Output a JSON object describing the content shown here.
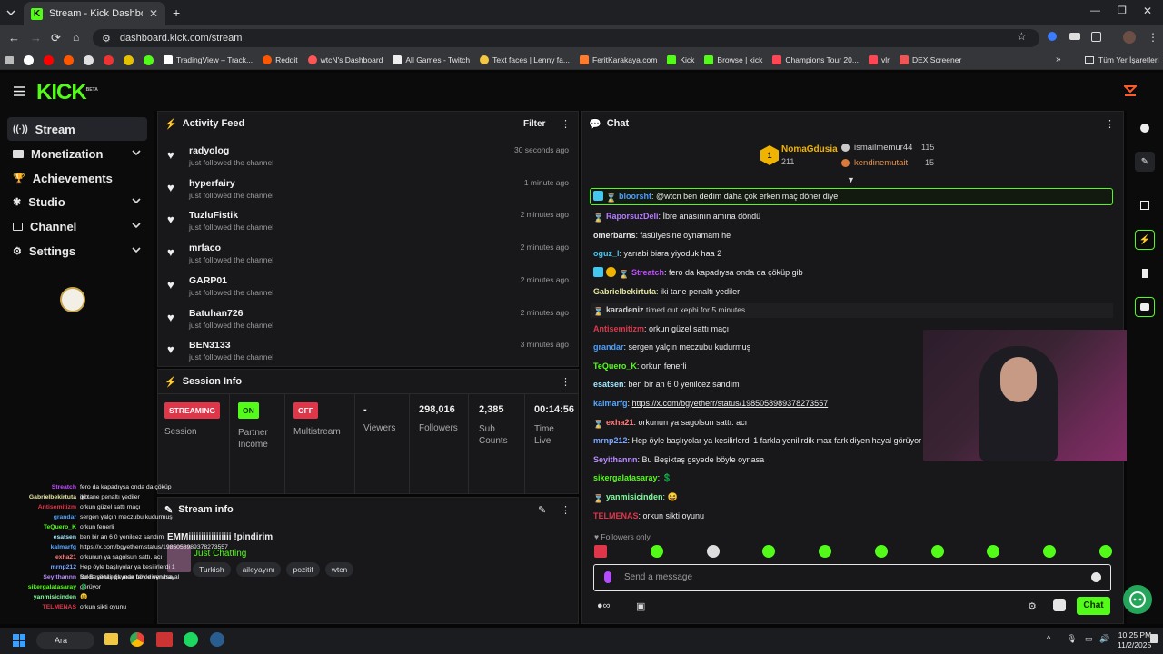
{
  "browser": {
    "tab_title": "Stream - Kick Dashboard",
    "url": "dashboard.kick.com/stream",
    "bookmarks": [
      "TradingView – Track...",
      "Reddit",
      "wtcN's Dashboard",
      "All Games - Twitch",
      "Text faces | Lenny fa...",
      "FeritKarakaya.com",
      "Kick",
      "Browse | kick",
      "Champions Tour 20...",
      "vlr",
      "DEX Screener"
    ],
    "all_bookmarks": "Tüm Yer İşaretleri"
  },
  "app": {
    "logo": "KICK",
    "logo_tag": "BETA"
  },
  "nav": [
    {
      "label": "Stream",
      "icon": "stream-icon",
      "active": true
    },
    {
      "label": "Monetization",
      "icon": "money-icon",
      "expand": true
    },
    {
      "label": "Achievements",
      "icon": "trophy-icon",
      "expand": false
    },
    {
      "label": "Studio",
      "icon": "studio-icon",
      "expand": true
    },
    {
      "label": "Channel",
      "icon": "channel-icon",
      "expand": true
    },
    {
      "label": "Settings",
      "icon": "gear-icon",
      "expand": true
    }
  ],
  "activity": {
    "title": "Activity Feed",
    "filter": "Filter",
    "items": [
      {
        "name": "radyolog",
        "action": "just followed the channel",
        "time": "30 seconds ago"
      },
      {
        "name": "hyperfairy",
        "action": "just followed the channel",
        "time": "1 minute ago"
      },
      {
        "name": "TuzluFistik",
        "action": "just followed the channel",
        "time": "2 minutes ago"
      },
      {
        "name": "mrfaco",
        "action": "just followed the channel",
        "time": "2 minutes ago"
      },
      {
        "name": "GARP01",
        "action": "just followed the channel",
        "time": "2 minutes ago"
      },
      {
        "name": "Batuhan726",
        "action": "just followed the channel",
        "time": "2 minutes ago"
      },
      {
        "name": "BEN3133",
        "action": "just followed the channel",
        "time": "3 minutes ago"
      }
    ]
  },
  "session": {
    "title": "Session Info",
    "streaming_badge": "STREAMING",
    "session_label": "Session",
    "on_badge": "ON",
    "partner_label": "Partner Income",
    "off_badge": "OFF",
    "multistream_label": "Multistream",
    "viewers_value": "-",
    "viewers_label": "Viewers",
    "followers_value": "298,016",
    "followers_label": "Followers",
    "subs_value": "2,385",
    "subs_label": "Sub Counts",
    "time_value": "00:14:56",
    "time_label": "Time Live"
  },
  "stream_info": {
    "title": "Stream info",
    "stream_title": "EMMiiiiiiiiiiiiiiiii !pindirim",
    "category": "Just Chatting",
    "tags": [
      "Turkish",
      "aileyayını",
      "pozitif",
      "wtcn"
    ]
  },
  "chat": {
    "title": "Chat",
    "top1": {
      "rank": "1",
      "name": "NomaGdusia",
      "count": "211"
    },
    "top2": {
      "name": "ismailmemur44",
      "count": "115"
    },
    "top3": {
      "name": "kendinemutait",
      "count": "15"
    },
    "messages": [
      {
        "user": "bloorsht",
        "color": "#4a9cff",
        "text": "@wtcn ben dedim daha çok erken maç döner diye",
        "highlight": true
      },
      {
        "user": "RaporsuzDeli",
        "color": "#b57cff",
        "text": "İbre anasının amına döndü"
      },
      {
        "user": "omerbarns",
        "color": "#e8e8e8",
        "text": "fasülyesine oynamam he"
      },
      {
        "user": "oguz_l",
        "color": "#45c8f0",
        "text": "yarıabi biara yiyoduk haa 2"
      },
      {
        "user": "Streatch",
        "color": "#c04cff",
        "text": "fero da kapadıysa onda da çöküp gib"
      },
      {
        "user": "Gabrielbekirtuta",
        "color": "#e6e6a0",
        "text": "iki tane penaltı yediler"
      },
      {
        "user": "karadeniz",
        "color": "#d0d0d0",
        "text": "timed out xephi for 5 minutes",
        "system": true
      },
      {
        "user": "Antisemitizm",
        "color": "#e0364a",
        "text": "orkun güzel sattı maçı"
      },
      {
        "user": "grandar",
        "color": "#4aa0ff",
        "text": "sergen yalçın meczubu kudurmuş"
      },
      {
        "user": "TeQuero_K",
        "color": "#53fc18",
        "text": "orkun fenerli"
      },
      {
        "user": "esatsen",
        "color": "#9ee8ff",
        "text": "ben bir an 6 0 yenilcez sandım"
      },
      {
        "user": "kalmarfg",
        "color": "#5aa8ff",
        "text": "https://x.com/bgyetherr/status/1985058989378273557",
        "link": true
      },
      {
        "user": "exha21",
        "color": "#ff7b7b",
        "text": "orkunun ya sagolsun sattı. acı"
      },
      {
        "user": "mrnp212",
        "color": "#7aa7ff",
        "text": "Hep öyle başlıyolar ya kesilirlerdi 1 farkla yenilirdik max fark diyen hayal görüyor"
      },
      {
        "user": "Seyithannn",
        "color": "#b88cff",
        "text": "Bu Beşiktaş gsyede böyle oynasa"
      },
      {
        "user": "sikergalatasaray",
        "color": "#53fc18",
        "text": "💲"
      },
      {
        "user": "yanmisicinden",
        "color": "#7dff9c",
        "text": "😆"
      },
      {
        "user": "TELMENAS",
        "color": "#e0364a",
        "text": "orkun sikti oyunu"
      }
    ],
    "followers_only": "Followers only",
    "input_placeholder": "Send a message",
    "send_label": "Chat"
  },
  "overlay": [
    {
      "u": "Streatch",
      "t": "fero da kapadıysa onda da çöküp gib",
      "c": "#c04cff"
    },
    {
      "u": "Gabrielbekirtuta",
      "t": "iki tane penaltı yediler",
      "c": "#e6e6a0"
    },
    {
      "u": "Antisemitizm",
      "t": "orkun güzel sattı maçı",
      "c": "#e0364a"
    },
    {
      "u": "grandar",
      "t": "sergen yalçın meczubu kudurmuş",
      "c": "#4aa0ff"
    },
    {
      "u": "TeQuero_K",
      "t": "orkun fenerli",
      "c": "#53fc18"
    },
    {
      "u": "esatsen",
      "t": "ben bir an 6 0 yenilcez sandım",
      "c": "#9ee8ff"
    },
    {
      "u": "kalmarfg",
      "t": "https://x.com/bgyetherr/status/1985058989378273557",
      "c": "#5aa8ff"
    },
    {
      "u": "exha21",
      "t": "orkunun ya sagolsun sattı. acı",
      "c": "#ff7b7b"
    },
    {
      "u": "mrnp212",
      "t": "Hep öyle başlıyolar ya kesilirlerdi 1 farkla yenilirdik max fark diyen hayal görüyor",
      "c": "#7aa7ff"
    },
    {
      "u": "Seyithannn",
      "t": "Bu Beşiktaş gsyede böyle oynasa",
      "c": "#b88cff"
    },
    {
      "u": "sikergalatasaray",
      "t": "💲",
      "c": "#53fc18"
    },
    {
      "u": "yanmisicinden",
      "t": "😆",
      "c": "#7dff9c"
    },
    {
      "u": "TELMENAS",
      "t": "orkun sikti oyunu",
      "c": "#e0364a"
    }
  ],
  "taskbar": {
    "search": "Ara",
    "time": "10:25 PM",
    "date": "11/2/2025"
  },
  "colors": {
    "accent": "#53fc18",
    "bg": "#0b0b0c",
    "panel": "#18181b",
    "danger": "#e0364a"
  }
}
